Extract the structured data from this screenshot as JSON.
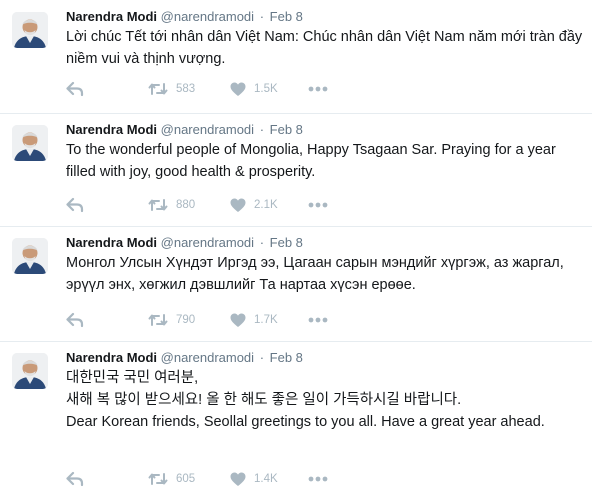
{
  "tweets": [
    {
      "name": "Narendra Modi",
      "handle": "@narendramodi",
      "dot": "·",
      "time": "Feb 8",
      "text": "Lời chúc Tết tới nhân dân Việt Nam: Chúc nhân dân Việt Nam năm mới tràn đầy niềm vui và thịnh vượng.",
      "retweets": "583",
      "likes": "1.5K"
    },
    {
      "name": "Narendra Modi",
      "handle": "@narendramodi",
      "dot": "·",
      "time": "Feb 8",
      "text": "To the wonderful people of Mongolia, Happy Tsagaan Sar. Praying for a year filled with joy, good health & prosperity.",
      "retweets": "880",
      "likes": "2.1K"
    },
    {
      "name": "Narendra Modi",
      "handle": "@narendramodi",
      "dot": "·",
      "time": "Feb 8",
      "text": "Монгол Улсын Хүндэт Иргэд ээ, Цагаан сарын мэндийг хүргэж, аз жаргал, эрүүл энх, хөгжил дэвшлийг Та нартаа хүсэн ерөөе.",
      "retweets": "790",
      "likes": "1.7K"
    },
    {
      "name": "Narendra Modi",
      "handle": "@narendramodi",
      "dot": "·",
      "time": "Feb 8",
      "text": "대한민국 국민 여러분,\n새해 복 많이 받으세요! 올 한 해도 좋은 일이 가득하시길 바랍니다.\nDear Korean friends, Seollal greetings to you all. Have a great year ahead.",
      "retweets": "605",
      "likes": "1.4K"
    }
  ],
  "icons": {
    "reply": "reply-arrow-icon",
    "retweet": "retweet-icon",
    "like": "heart-icon",
    "more": "more-dots-icon"
  },
  "colors": {
    "text": "#14171a",
    "muted": "#657786",
    "icon": "#aab8c2",
    "border": "#e6ecf0"
  }
}
